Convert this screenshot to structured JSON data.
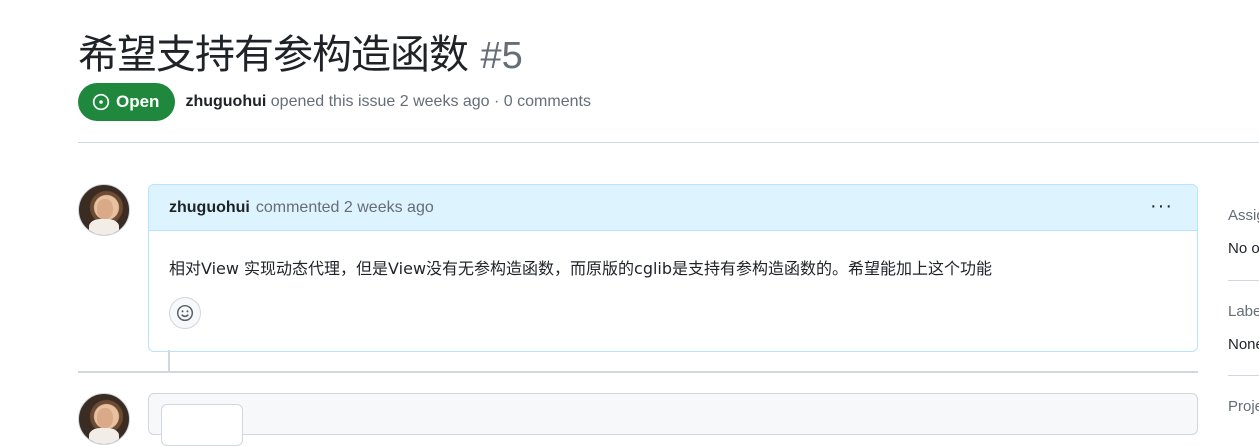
{
  "issue": {
    "title": "希望支持有参构造函数",
    "number": "#5",
    "state": "Open",
    "author": "zhuguohui",
    "meta": "opened this issue 2 weeks ago · 0 comments"
  },
  "comment": {
    "author": "zhuguohui",
    "action": "commented 2 weeks ago",
    "body": "相对View 实现动态代理，但是View没有无参构造函数，而原版的cglib是支持有参构造函数的。希望能加上这个功能",
    "more": "···"
  },
  "sidebar": {
    "assignees_label": "Assig",
    "assignees_value": "No o",
    "labels_label": "Labe",
    "labels_value": "None",
    "projects_label": "Proje"
  },
  "colors": {
    "open_badge": "#1f883d",
    "comment_header_bg": "#ddf4ff",
    "comment_border": "#b6e3ff"
  }
}
